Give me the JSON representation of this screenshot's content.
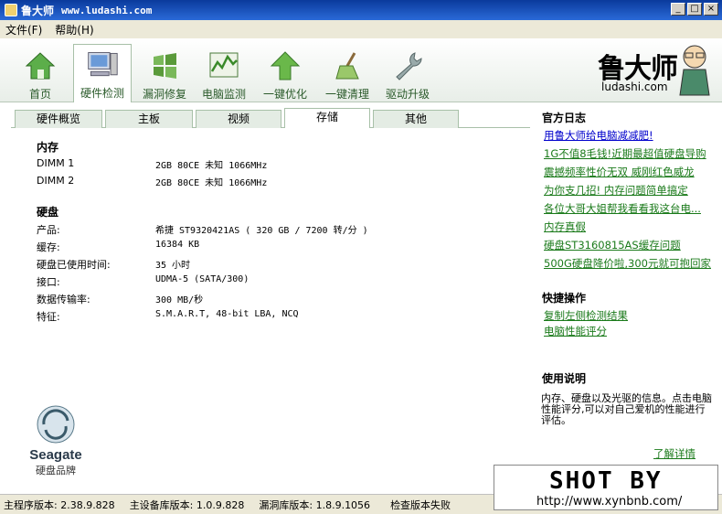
{
  "window": {
    "title": "鲁大师",
    "url": "www.ludashi.com",
    "min": "_",
    "max": "□",
    "close": "×"
  },
  "menu": {
    "file": "文件(F)",
    "help": "帮助(H)"
  },
  "toolbar": {
    "items": [
      {
        "label": "首页",
        "icon": "home-icon"
      },
      {
        "label": "硬件检测",
        "icon": "computer-icon"
      },
      {
        "label": "漏洞修复",
        "icon": "windows-icon"
      },
      {
        "label": "电脑监测",
        "icon": "monitor-chart-icon"
      },
      {
        "label": "一键优化",
        "icon": "arrow-up-icon"
      },
      {
        "label": "一键清理",
        "icon": "broom-icon"
      },
      {
        "label": "驱动升级",
        "icon": "wrench-icon"
      }
    ],
    "active": 1,
    "logo_text": "鲁大师",
    "logo_url": "ludashi.com"
  },
  "tabs": [
    "硬件概览",
    "主板",
    "视频",
    "存储",
    "其他"
  ],
  "active_tab": 3,
  "memory": {
    "title": "内存",
    "rows": [
      {
        "k": "DIMM 1",
        "v": "2GB 80CE 未知 1066MHz"
      },
      {
        "k": "DIMM 2",
        "v": "2GB 80CE 未知 1066MHz"
      }
    ]
  },
  "disk": {
    "title": "硬盘",
    "rows": [
      {
        "k": "产品:",
        "v": "希捷 ST9320421AS ( 320 GB / 7200 转/分 )"
      },
      {
        "k": "缓存:",
        "v": "16384 KB"
      },
      {
        "k": "硬盘已使用时间:",
        "v": "35 小时"
      },
      {
        "k": "接口:",
        "v": "UDMA-5 (SATA/300)"
      },
      {
        "k": "数据传输率:",
        "v": "300 MB/秒"
      },
      {
        "k": "特征:",
        "v": "S.M.A.R.T,  48-bit LBA,  NCQ"
      }
    ]
  },
  "brand": {
    "name": "Seagate",
    "caption": "硬盘品牌"
  },
  "sidebar": {
    "log_title": "官方日志",
    "links": [
      "用鲁大师给电脑减减肥!",
      "1G不值8毛钱!近期最超值硬盘导购",
      "震撼频率性价无双 威刚红色威龙",
      "为你支几招! 内存问题简单搞定",
      "各位大哥大姐帮我看看我这台电...",
      "内存真假",
      "硬盘ST3160815AS缓存问题",
      "500G硬盘降价啦,300元就可抱回家"
    ],
    "quick_title": "快捷操作",
    "quick_links": [
      "复制左侧检测结果",
      "电脑性能评分"
    ],
    "usage_title": "使用说明",
    "usage_text": "内存、硬盘以及光驱的信息。点击电脑性能评分,可以对自己爱机的性能进行评估。",
    "more": "了解详情"
  },
  "status": {
    "main_ver": "主程序版本: 2.38.9.828",
    "dev_ver": "主设备库版本: 1.0.9.828",
    "vuln_ver": "漏洞库版本: 1.8.9.1056",
    "check": "检查版本失败"
  },
  "watermark": {
    "big": "SHOT BY",
    "url": "http://www.xynbnb.com/"
  }
}
